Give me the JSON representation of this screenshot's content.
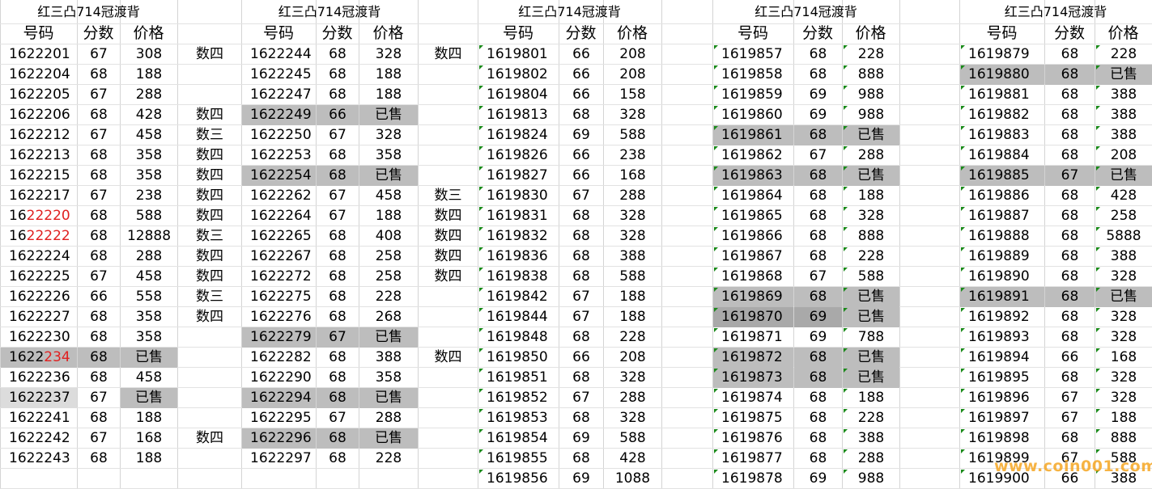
{
  "blocks": [
    {
      "title": "红三凸714冠渡背",
      "headers": [
        "号码",
        "分数",
        "价格"
      ],
      "rows": [
        {
          "num": "1622201",
          "score": "67",
          "price": "308",
          "note": "数四"
        },
        {
          "num": "1622204",
          "score": "68",
          "price": "188",
          "note": ""
        },
        {
          "num": "1622205",
          "score": "67",
          "price": "288",
          "note": ""
        },
        {
          "num": "1622206",
          "score": "68",
          "price": "428",
          "note": "数四"
        },
        {
          "num": "1622212",
          "score": "67",
          "price": "458",
          "note": "数三"
        },
        {
          "num": "1622213",
          "score": "68",
          "price": "358",
          "note": "数四"
        },
        {
          "num": "1622215",
          "score": "68",
          "price": "358",
          "note": "数四"
        },
        {
          "num": "1622217",
          "score": "67",
          "price": "238",
          "note": "数四"
        },
        {
          "num": "1622220",
          "score": "68",
          "price": "588",
          "note": "数四",
          "num_prefix": "16",
          "num_red": "22220"
        },
        {
          "num": "1622222",
          "score": "68",
          "price": "12888",
          "note": "数三",
          "num_prefix": "16",
          "num_red": "22222"
        },
        {
          "num": "1622224",
          "score": "68",
          "price": "288",
          "note": "数四"
        },
        {
          "num": "1622225",
          "score": "67",
          "price": "458",
          "note": "数四"
        },
        {
          "num": "1622226",
          "score": "66",
          "price": "558",
          "note": "数三"
        },
        {
          "num": "1622227",
          "score": "68",
          "price": "358",
          "note": "数四"
        },
        {
          "num": "1622230",
          "score": "68",
          "price": "358",
          "note": ""
        },
        {
          "num": "1622234",
          "score": "68",
          "price": "已售",
          "note": "",
          "sold": true,
          "num_prefix": "1622",
          "num_red": "234"
        },
        {
          "num": "1622236",
          "score": "68",
          "price": "458",
          "note": ""
        },
        {
          "num": "1622237",
          "score": "67",
          "price": "已售",
          "note": "",
          "light": true
        },
        {
          "num": "1622241",
          "score": "68",
          "price": "188",
          "note": ""
        },
        {
          "num": "1622242",
          "score": "67",
          "price": "168",
          "note": "数四"
        },
        {
          "num": "1622243",
          "score": "68",
          "price": "188",
          "note": ""
        }
      ]
    },
    {
      "title": "红三凸714冠渡背",
      "headers": [
        "号码",
        "分数",
        "价格"
      ],
      "rows": [
        {
          "num": "1622244",
          "score": "68",
          "price": "328",
          "note": "数四"
        },
        {
          "num": "1622245",
          "score": "68",
          "price": "188",
          "note": ""
        },
        {
          "num": "1622247",
          "score": "68",
          "price": "188",
          "note": ""
        },
        {
          "num": "1622249",
          "score": "66",
          "price": "已售",
          "note": "",
          "sold": true
        },
        {
          "num": "1622250",
          "score": "67",
          "price": "328",
          "note": ""
        },
        {
          "num": "1622253",
          "score": "68",
          "price": "358",
          "note": ""
        },
        {
          "num": "1622254",
          "score": "68",
          "price": "已售",
          "note": "",
          "sold": true
        },
        {
          "num": "1622262",
          "score": "67",
          "price": "458",
          "note": "数三"
        },
        {
          "num": "1622264",
          "score": "67",
          "price": "188",
          "note": "数四"
        },
        {
          "num": "1622265",
          "score": "68",
          "price": "408",
          "note": "数四"
        },
        {
          "num": "1622267",
          "score": "68",
          "price": "258",
          "note": "数四"
        },
        {
          "num": "1622272",
          "score": "68",
          "price": "258",
          "note": "数四"
        },
        {
          "num": "1622275",
          "score": "68",
          "price": "228",
          "note": ""
        },
        {
          "num": "1622276",
          "score": "68",
          "price": "268",
          "note": ""
        },
        {
          "num": "1622279",
          "score": "67",
          "price": "已售",
          "note": "",
          "sold": true
        },
        {
          "num": "1622282",
          "score": "68",
          "price": "388",
          "note": "数四"
        },
        {
          "num": "1622290",
          "score": "68",
          "price": "358",
          "note": ""
        },
        {
          "num": "1622294",
          "score": "68",
          "price": "已售",
          "note": "",
          "sold": true
        },
        {
          "num": "1622295",
          "score": "67",
          "price": "288",
          "note": ""
        },
        {
          "num": "1622296",
          "score": "68",
          "price": "已售",
          "note": "",
          "sold": true
        },
        {
          "num": "1622297",
          "score": "68",
          "price": "228",
          "note": ""
        }
      ]
    },
    {
      "title": "红三凸714冠渡背",
      "headers": [
        "号码",
        "分数",
        "价格"
      ],
      "rows": [
        {
          "num": "1619801",
          "score": "66",
          "price": "208"
        },
        {
          "num": "1619802",
          "score": "66",
          "price": "208"
        },
        {
          "num": "1619804",
          "score": "66",
          "price": "158"
        },
        {
          "num": "1619813",
          "score": "68",
          "price": "328"
        },
        {
          "num": "1619824",
          "score": "69",
          "price": "588"
        },
        {
          "num": "1619826",
          "score": "66",
          "price": "238"
        },
        {
          "num": "1619827",
          "score": "66",
          "price": "168"
        },
        {
          "num": "1619830",
          "score": "67",
          "price": "288"
        },
        {
          "num": "1619831",
          "score": "68",
          "price": "328"
        },
        {
          "num": "1619832",
          "score": "68",
          "price": "328"
        },
        {
          "num": "1619836",
          "score": "68",
          "price": "388"
        },
        {
          "num": "1619838",
          "score": "68",
          "price": "588"
        },
        {
          "num": "1619842",
          "score": "67",
          "price": "188"
        },
        {
          "num": "1619844",
          "score": "67",
          "price": "188"
        },
        {
          "num": "1619848",
          "score": "68",
          "price": "228"
        },
        {
          "num": "1619850",
          "score": "66",
          "price": "208"
        },
        {
          "num": "1619851",
          "score": "68",
          "price": "328"
        },
        {
          "num": "1619852",
          "score": "67",
          "price": "288"
        },
        {
          "num": "1619853",
          "score": "68",
          "price": "328"
        },
        {
          "num": "1619854",
          "score": "69",
          "price": "588"
        },
        {
          "num": "1619855",
          "score": "68",
          "price": "428"
        },
        {
          "num": "1619856",
          "score": "69",
          "price": "1088"
        }
      ]
    },
    {
      "title": "红三凸714冠渡背",
      "headers": [
        "号码",
        "分数",
        "价格"
      ],
      "rows": [
        {
          "num": "1619857",
          "score": "68",
          "price": "228"
        },
        {
          "num": "1619858",
          "score": "68",
          "price": "888"
        },
        {
          "num": "1619859",
          "score": "69",
          "price": "988"
        },
        {
          "num": "1619860",
          "score": "69",
          "price": "988"
        },
        {
          "num": "1619861",
          "score": "68",
          "price": "已售",
          "sold": true
        },
        {
          "num": "1619862",
          "score": "67",
          "price": "288"
        },
        {
          "num": "1619863",
          "score": "68",
          "price": "已售",
          "sold": true
        },
        {
          "num": "1619864",
          "score": "68",
          "price": "188"
        },
        {
          "num": "1619865",
          "score": "68",
          "price": "328"
        },
        {
          "num": "1619866",
          "score": "68",
          "price": "888"
        },
        {
          "num": "1619867",
          "score": "68",
          "price": "228"
        },
        {
          "num": "1619868",
          "score": "67",
          "price": "588"
        },
        {
          "num": "1619869",
          "score": "68",
          "price": "已售",
          "sold": true
        },
        {
          "num": "1619870",
          "score": "69",
          "price": "已售",
          "sold": true,
          "dark": true
        },
        {
          "num": "1619871",
          "score": "69",
          "price": "788"
        },
        {
          "num": "1619872",
          "score": "68",
          "price": "已售",
          "sold": true
        },
        {
          "num": "1619873",
          "score": "68",
          "price": "已售",
          "sold": true
        },
        {
          "num": "1619874",
          "score": "68",
          "price": "188"
        },
        {
          "num": "1619875",
          "score": "68",
          "price": "228"
        },
        {
          "num": "1619876",
          "score": "68",
          "price": "388"
        },
        {
          "num": "1619877",
          "score": "68",
          "price": "288"
        },
        {
          "num": "1619878",
          "score": "69",
          "price": "988"
        }
      ]
    },
    {
      "title": "红三凸714冠渡背",
      "headers": [
        "号码",
        "分数",
        "价格"
      ],
      "rows": [
        {
          "num": "1619879",
          "score": "68",
          "price": "228"
        },
        {
          "num": "1619880",
          "score": "68",
          "price": "已售",
          "sold": true
        },
        {
          "num": "1619881",
          "score": "68",
          "price": "388"
        },
        {
          "num": "1619882",
          "score": "68",
          "price": "388"
        },
        {
          "num": "1619883",
          "score": "68",
          "price": "388"
        },
        {
          "num": "1619884",
          "score": "68",
          "price": "208"
        },
        {
          "num": "1619885",
          "score": "67",
          "price": "已售",
          "sold": true
        },
        {
          "num": "1619886",
          "score": "68",
          "price": "428"
        },
        {
          "num": "1619887",
          "score": "68",
          "price": "258"
        },
        {
          "num": "1619888",
          "score": "68",
          "price": "5888"
        },
        {
          "num": "1619889",
          "score": "68",
          "price": "388"
        },
        {
          "num": "1619890",
          "score": "68",
          "price": "328"
        },
        {
          "num": "1619891",
          "score": "68",
          "price": "已售",
          "sold": true
        },
        {
          "num": "1619892",
          "score": "68",
          "price": "328"
        },
        {
          "num": "1619893",
          "score": "68",
          "price": "328"
        },
        {
          "num": "1619894",
          "score": "66",
          "price": "168"
        },
        {
          "num": "1619895",
          "score": "68",
          "price": "328"
        },
        {
          "num": "1619896",
          "score": "67",
          "price": "328"
        },
        {
          "num": "1619897",
          "score": "67",
          "price": "188"
        },
        {
          "num": "1619898",
          "score": "68",
          "price": "888"
        },
        {
          "num": "1619899",
          "score": "67",
          "price": "588"
        },
        {
          "num": "1619900",
          "score": "66",
          "price": "388"
        }
      ]
    }
  ],
  "watermark": "www.coin001.com"
}
